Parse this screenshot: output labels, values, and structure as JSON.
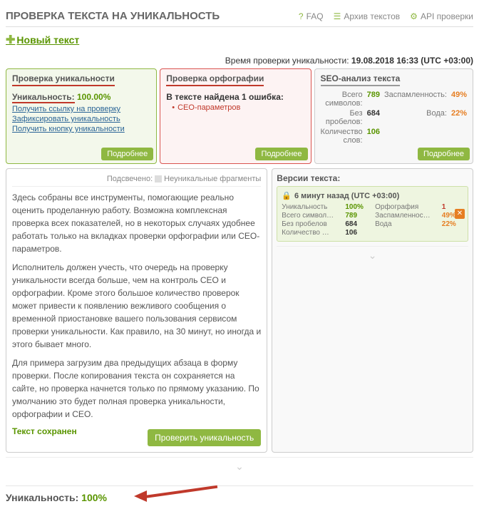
{
  "header": {
    "title": "ПРОВЕРКА ТЕКСТА НА УНИКАЛЬНОСТЬ",
    "faq": "FAQ",
    "archive": "Архив текстов",
    "api": "API проверки"
  },
  "new_text": "Новый текст",
  "time": {
    "label": "Время проверки уникальности:",
    "value": "19.08.2018 16:33 (UTC +03:00)"
  },
  "panel_uniq": {
    "title": "Проверка уникальности",
    "label": "Уникальность:",
    "value": "100.00%",
    "link1": "Получить ссылку на проверку",
    "link2": "Зафиксировать уникальность",
    "link3": "Получить кнопку уникальности",
    "more": "Подробнее"
  },
  "panel_spell": {
    "title": "Проверка орфографии",
    "found": "В тексте найдена 1 ошибка:",
    "err1": "СЕО-параметров",
    "more": "Подробнее"
  },
  "panel_seo": {
    "title": "SEO-анализ текста",
    "rows": {
      "l1": "Всего символов:",
      "v1": "789",
      "l2": "Заспамленность:",
      "v2": "49%",
      "l3": "Без пробелов:",
      "v3": "684",
      "l4": "Вода:",
      "v4": "22%",
      "l5": "Количество слов:",
      "v5": "106"
    },
    "more": "Подробнее"
  },
  "highlight": {
    "label": "Подсвечено:",
    "legend": "Неуникальные фрагменты"
  },
  "text": {
    "p1": "Здесь собраны все инструменты, помогающие реально оценить проделанную работу. Возможна комплексная проверка всех показателей, но в некоторых случаях удобнее работать только на вкладках проверки орфографии или СЕО-параметров.",
    "p2": "Исполнитель должен учесть, что очередь на проверку уникальности всегда больше, чем на контроль СЕО и орфографии. Кроме этого большое количество проверок может привести к появлению вежливого сообщения о временной приостановке вашего пользования сервисом проверки уникальности. Как правило, на 30 минут, но иногда и этого бывает много.",
    "p3": "Для примера загрузим два предыдущих абзаца в форму проверки. После копирования текста он сохраняется на сайте, но проверка начнется только по прямому указанию. По умолчанию это будет полная проверка уникальности, орфографии и СЕО."
  },
  "saved": "Текст сохранен",
  "check_btn": "Проверить уникальность",
  "versions": {
    "title": "Версии текста:",
    "time": "6 минут назад  (UTC +03:00)",
    "rows": {
      "l1": "Уникальность",
      "v1": "100%",
      "l2": "Орфография",
      "v2": "1",
      "l3": "Всего символ…",
      "v3": "789",
      "l4": "Заспамленнос…",
      "v4": "49%",
      "l5": "Без пробелов",
      "v5": "684",
      "l6": "Вода",
      "v6": "22%",
      "l7": "Количество …",
      "v7": "106"
    }
  },
  "bottom": {
    "label": "Уникальность:",
    "value": "100%"
  }
}
